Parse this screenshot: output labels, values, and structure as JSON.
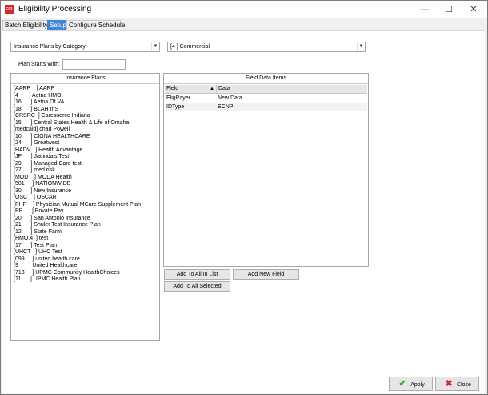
{
  "window": {
    "title": "Eligibility Processing",
    "icon_text": "ECL",
    "minimize": "—",
    "maximize": "☐",
    "close": "✕"
  },
  "tabs": [
    {
      "label": "Batch Eligibility"
    },
    {
      "label": "Setup"
    },
    {
      "label": "Configure Schedule"
    }
  ],
  "filters": {
    "category": "Insurance Plans by Category",
    "plan_type": "[4     ] Commercial",
    "plan_starts_label": "Plan Starts With:",
    "plan_starts_value": ""
  },
  "insurance_plans": {
    "title": "Insurance Plans",
    "items": [
      "[AARP    ] AARP",
      "[4       ] Aetna HMO",
      "[16      ] Aetna Of VA",
      "[18      ] BLAH IriS",
      "[CRSRC  ] Caresuorce Indiana",
      "[15      ] Central States Health & Life of Omaha",
      "[medcaid] chad Powell",
      "[10      ] CIGNA HEALTHCARE",
      "[24      ] Greatwest",
      "[HADV   ] Health Advantage",
      "[JP      ] Jacinda's Test",
      "[29      ] Managed Care test",
      "[27      ] med risk",
      "[MOD    ] MODA Health",
      "[501     ] NATIONWIDE",
      "[30      ] New Insurance",
      "[OSC    ] OSCAR",
      "[PHP    ] Physician Mutual MCare Supplement Plan",
      "[PP      ] Private Pay",
      "[20      ] San Antonio Insurance",
      "[21      ] Shuler Test Insurance Plan",
      "[12      ] State Farm",
      "[HMO.4  ] test",
      "[17      ] Test Plan",
      "[UHCT   ] UHC Test",
      "[099     ] united health care",
      "[9       ] United Healthcare",
      "[713     ] UPMC Community HealthChoices",
      "[11      ] UPMC Health Plan"
    ]
  },
  "field_data": {
    "title": "Field Data Items",
    "columns": [
      "Field",
      "Data"
    ],
    "rows": [
      {
        "field": "EligPayer",
        "data": "New Data"
      },
      {
        "field": "IDType",
        "data": "ECNPI"
      }
    ]
  },
  "buttons": {
    "add_all_in_list": "Add To All In List",
    "add_new_field": "Add New Field",
    "add_all_selected": "Add To All Selected",
    "apply": "Apply",
    "close": "Close"
  },
  "colors": {
    "accent": "#3f86d8",
    "app_icon": "#d8232a",
    "apply_icon": "#3aa335",
    "close_icon": "#d8232a"
  }
}
